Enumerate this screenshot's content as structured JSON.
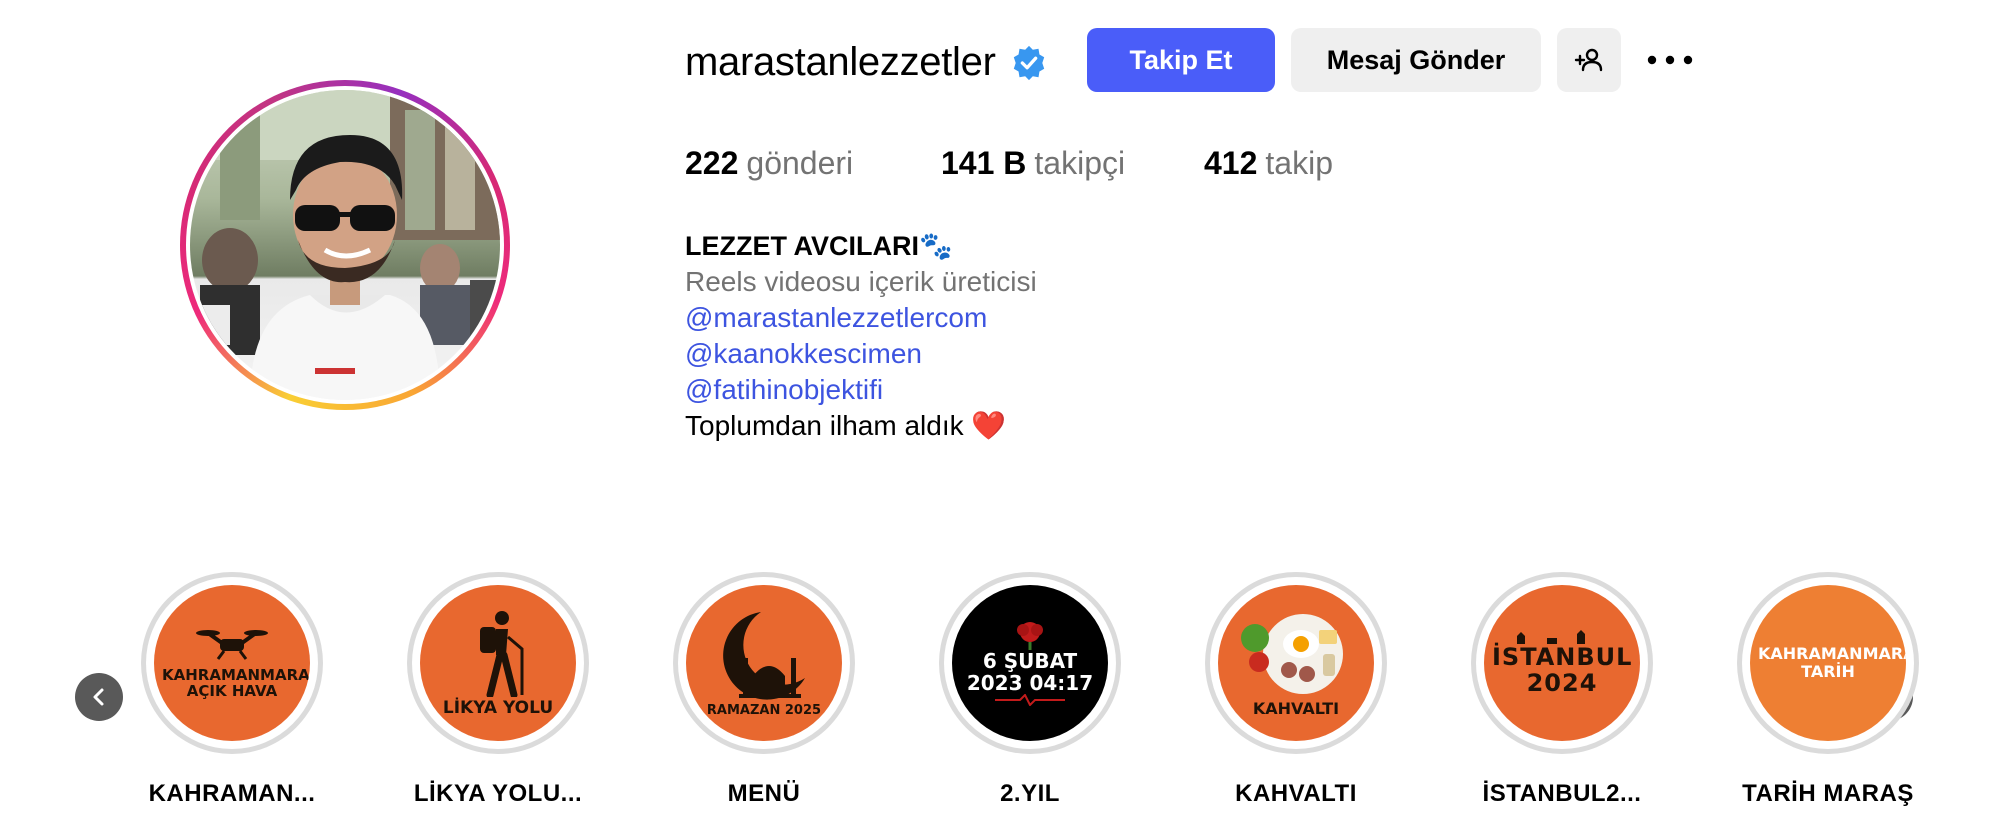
{
  "profile": {
    "username": "marastanlezzetler",
    "verified": true,
    "buttons": {
      "follow": "Takip Et",
      "message": "Mesaj Gönder"
    },
    "stats": {
      "posts_count": "222",
      "posts_label": "gönderi",
      "followers_count": "141 B",
      "followers_label": "takipçi",
      "following_count": "412",
      "following_label": "takip"
    },
    "bio": {
      "name": "LEZZET AVCILARI🐾",
      "category": "Reels videosu içerik üreticisi",
      "links": [
        "@marastanlezzetlercom",
        "@kaanokkescimen",
        "@fatihinobjektifi"
      ],
      "tagline": "Toplumdan ilham aldık ❤️"
    }
  },
  "highlights": [
    {
      "label": "KAHRAMAN...",
      "cover_text": "KAHRAMANMARAŞ AÇIK HAVA",
      "cover_bg": "#e8682f",
      "cover_fg": "#1e1208",
      "icon": "drone-icon"
    },
    {
      "label": "LİKYA YOLU...",
      "cover_text": "LİKYA YOLU",
      "cover_bg": "#e8682f",
      "cover_fg": "#1e1208",
      "icon": "hiker-icon"
    },
    {
      "label": "MENÜ",
      "cover_text": "RAMAZAN 2025",
      "cover_bg": "#e8682f",
      "cover_fg": "#1e1208",
      "icon": "mosque-crescent-icon"
    },
    {
      "label": "2.YIL",
      "cover_text": "6 ŞUBAT 2023 04:17",
      "cover_bg": "#000000",
      "cover_fg": "#ffffff",
      "icon": "carnation-icon"
    },
    {
      "label": "KAHVALTI",
      "cover_text": "KAHVALTI",
      "cover_bg": "#e8682f",
      "cover_fg": "#1e1208",
      "icon": "breakfast-plate-icon"
    },
    {
      "label": "İSTANBUL2...",
      "cover_text": "İSTANBUL 2024",
      "cover_bg": "#e8682f",
      "cover_fg": "#1e1208",
      "icon": "skyline-icon"
    },
    {
      "label": "TARİH MARAŞ",
      "cover_text": "KAHRAMANMARAŞ TARİH",
      "cover_bg": "#ee7f33",
      "cover_fg": "#ffffff",
      "icon": "text-cover-icon"
    }
  ],
  "colors": {
    "accent": "#4a5df9",
    "link": "#3d54e0",
    "muted": "#737373",
    "button_bg": "#efefef",
    "verified": "#3897f0"
  }
}
